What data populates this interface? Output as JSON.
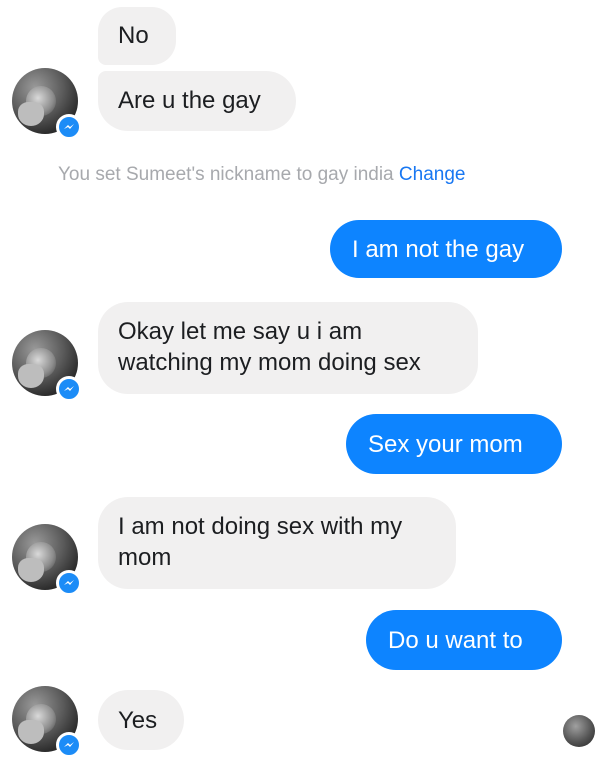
{
  "messages": [
    {
      "side": "in",
      "text": "No"
    },
    {
      "side": "in",
      "text": "Are u the gay"
    },
    {
      "side": "out",
      "text": "I am not the gay"
    },
    {
      "side": "in",
      "lines": [
        "Okay let me say u i am",
        "watching my mom doing sex"
      ]
    },
    {
      "side": "out",
      "text": "Sex your mom"
    },
    {
      "side": "in",
      "lines": [
        "I am not doing sex with my",
        "mom"
      ]
    },
    {
      "side": "out",
      "text": "Do u want to"
    },
    {
      "side": "in",
      "text": "Yes"
    }
  ],
  "system_notice": {
    "text": "You set Sumeet's nickname to gay india",
    "action": "Change"
  },
  "colors": {
    "outgoing_bubble": "#0d84ff",
    "incoming_bubble": "#f1f0f0",
    "system_text": "#a7a9ad",
    "link": "#1877f2",
    "messenger_badge": "#1c8cf7"
  },
  "icons": {
    "avatar_badge": "messenger-icon"
  }
}
